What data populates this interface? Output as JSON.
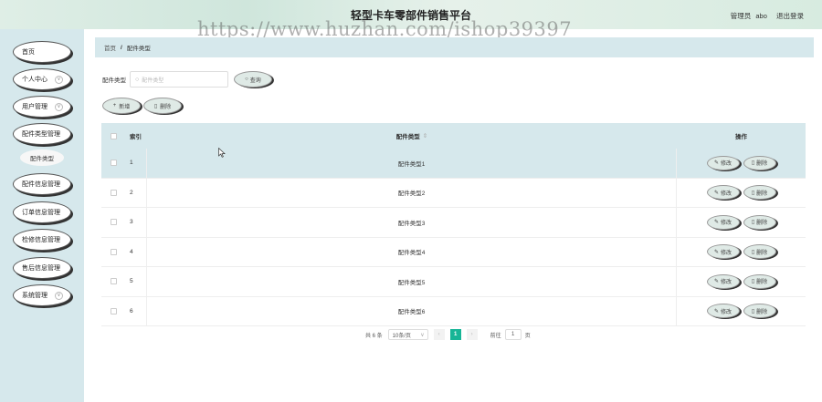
{
  "header": {
    "title": "轻型卡车零部件销售平台",
    "watermark": "https://www.huzhan.com/ishop39397",
    "role": "管理员",
    "username": "abo",
    "logout": "退出登录"
  },
  "sidebar": {
    "items": [
      {
        "label": "首页"
      },
      {
        "label": "个人中心",
        "chevron": "∨"
      },
      {
        "label": "用户管理",
        "chevron": "∨"
      },
      {
        "label": "配件类型管理"
      },
      {
        "label": "配件类型"
      },
      {
        "label": "配件信息管理"
      },
      {
        "label": "订单信息管理"
      },
      {
        "label": "检修信息管理"
      },
      {
        "label": "售后信息管理"
      },
      {
        "label": "系统管理",
        "chevron": "∨"
      }
    ]
  },
  "breadcrumb": {
    "home": "首页",
    "separator": "/",
    "current": "配件类型"
  },
  "search": {
    "label": "配件类型",
    "placeholder": "配件类型",
    "button": "查询"
  },
  "actions": {
    "add": "新增",
    "delete": "删除"
  },
  "table": {
    "headers": {
      "index": "索引",
      "type": "配件类型",
      "sort": "⇕",
      "ops": "操作"
    },
    "rows": [
      {
        "index": "1",
        "type": "配件类型1"
      },
      {
        "index": "2",
        "type": "配件类型2"
      },
      {
        "index": "3",
        "type": "配件类型3"
      },
      {
        "index": "4",
        "type": "配件类型4"
      },
      {
        "index": "5",
        "type": "配件类型5"
      },
      {
        "index": "6",
        "type": "配件类型6"
      }
    ],
    "row_edit": "修改",
    "row_delete": "删除"
  },
  "pagination": {
    "total": "共 6 条",
    "page_size": "10条/页",
    "current_page": "1",
    "goto_label": "前往",
    "goto_value": "1",
    "page_unit": "页"
  },
  "icons": {
    "search": "search-icon",
    "plus": "plus-icon",
    "trash": "trash-icon",
    "edit": "edit-icon"
  },
  "colors": {
    "accent": "#17b596",
    "panel": "#d6e8ec"
  }
}
